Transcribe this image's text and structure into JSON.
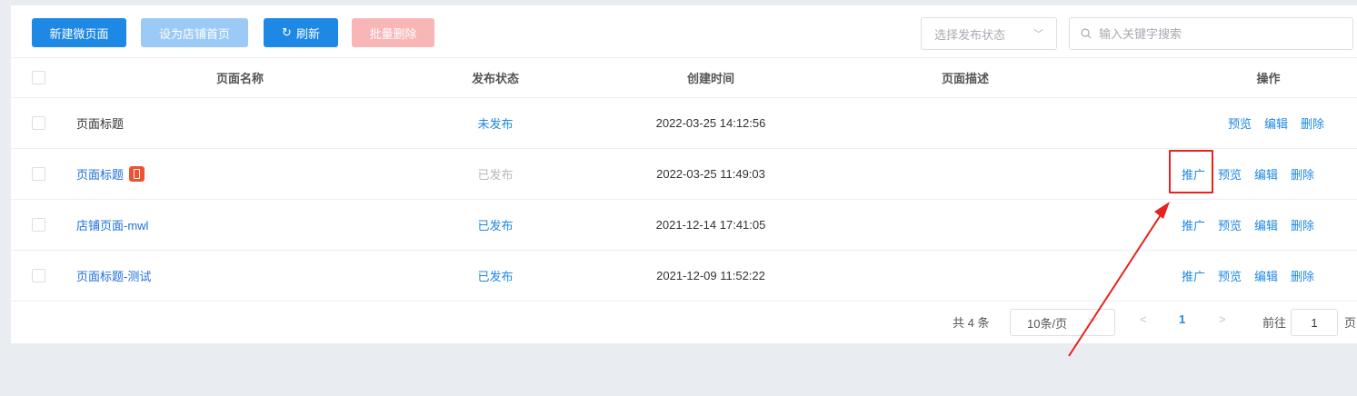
{
  "toolbar": {
    "new_label": "新建微页面",
    "set_home_label": "设为店铺首页",
    "refresh_label": "刷新",
    "refresh_icon": "refresh-icon",
    "batch_delete_label": "批量删除",
    "status_select": {
      "placeholder": "选择发布状态"
    },
    "search": {
      "placeholder": "输入关键字搜索",
      "value": ""
    }
  },
  "table": {
    "headers": {
      "name": "页面名称",
      "status": "发布状态",
      "created": "创建时间",
      "desc": "页面描述",
      "ops": "操作"
    },
    "rows": [
      {
        "name": "页面标题",
        "status": "未发布",
        "created": "2022-03-25 14:12:56",
        "desc": "",
        "ops": [
          "预览",
          "编辑",
          "删除"
        ]
      },
      {
        "name": "页面标题",
        "status": "已发布",
        "created": "2022-03-25 11:49:03",
        "desc": "",
        "home_badge_icon": "phone-icon",
        "ops": [
          "推广",
          "预览",
          "编辑",
          "删除"
        ]
      },
      {
        "name": "店铺页面-mwl",
        "status": "已发布",
        "created": "2021-12-14 17:41:05",
        "desc": "",
        "ops": [
          "推广",
          "预览",
          "编辑",
          "删除"
        ]
      },
      {
        "name": "页面标题-测试",
        "status": "已发布",
        "created": "2021-12-09 11:52:22",
        "desc": "",
        "ops": [
          "推广",
          "预览",
          "编辑",
          "删除"
        ]
      }
    ]
  },
  "pagination": {
    "total_text": "共 4 条",
    "page_size": "10条/页",
    "current_page": "1",
    "goto_label": "前往",
    "goto_value": "1",
    "page_suffix": "页"
  },
  "colors": {
    "primary": "#1e88e5",
    "annotation_red": "#e8231f",
    "badge": "#ef5230"
  }
}
